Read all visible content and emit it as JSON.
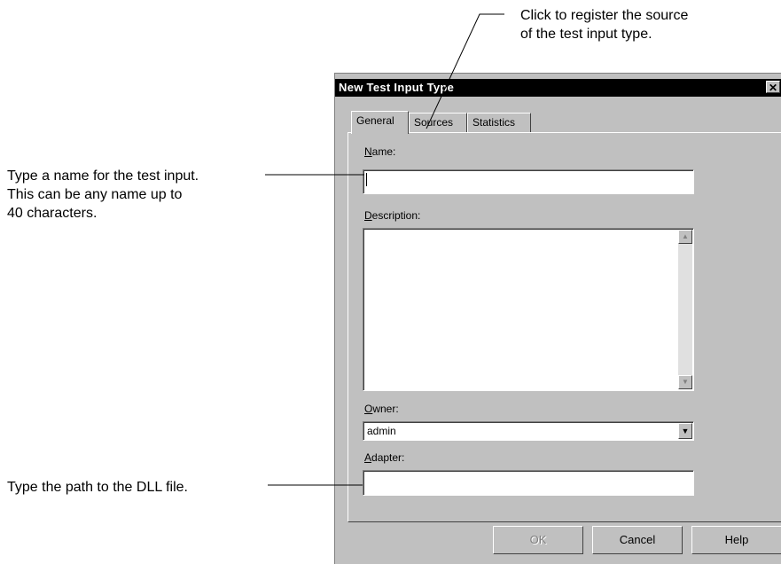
{
  "callouts": {
    "top": [
      "Click to register the source",
      "of the test input type."
    ],
    "name": [
      "Type a name for the test input.",
      "This can be any name up to",
      "40 characters."
    ],
    "adapter": [
      "Type the path to the DLL file."
    ]
  },
  "dialog": {
    "title": "New Test Input Type",
    "close_glyph": "✕",
    "tabs": [
      "General",
      "Sources",
      "Statistics"
    ],
    "active_tab": "General",
    "fields": {
      "name": {
        "label_key": "N",
        "label_rest": "ame:",
        "value": ""
      },
      "description": {
        "label_key": "D",
        "label_rest": "escription:",
        "value": ""
      },
      "owner": {
        "label_key": "O",
        "label_rest": "wner:",
        "value": "admin"
      },
      "adapter": {
        "label_key": "A",
        "label_rest": "dapter:",
        "value": ""
      }
    },
    "buttons": {
      "ok": "OK",
      "cancel": "Cancel",
      "help": "Help"
    },
    "icons": {
      "scroll_up": "scroll-up-arrow",
      "scroll_down": "scroll-down-arrow",
      "dropdown": "chevron-down"
    }
  }
}
